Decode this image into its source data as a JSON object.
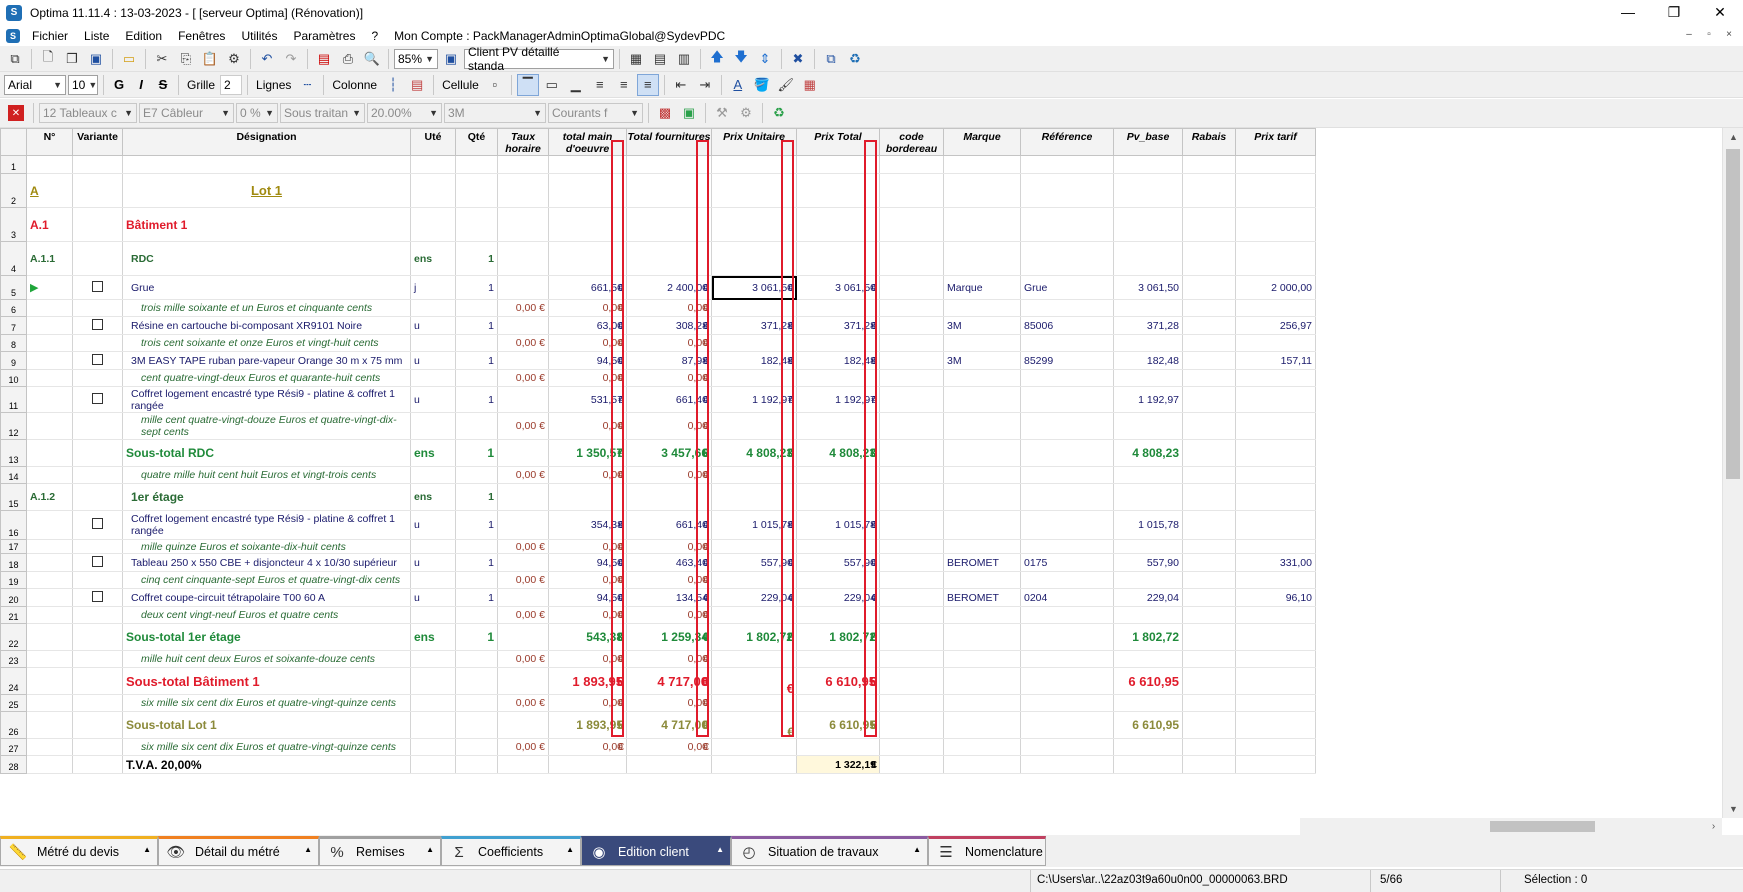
{
  "window": {
    "title": "Optima 11.11.4 : 13-03-2023 - [ [serveur Optima] (Rénovation)]",
    "minimize": "—",
    "restore": "❐",
    "close": "✕"
  },
  "menu": {
    "items": [
      "Fichier",
      "Liste",
      "Edition",
      "Fenêtres",
      "Utilités",
      "Paramètres",
      "?"
    ],
    "account": "Mon Compte : PackManagerAdminOptimaGlobal@SydevPDC",
    "mdi": [
      "–",
      "▫",
      "×"
    ]
  },
  "toolbar1": {
    "zoom": "85%",
    "client_view": "Client PV détaillé standa"
  },
  "toolbar2": {
    "font": "Arial",
    "font_size": "10",
    "bold": "G",
    "italic": "I",
    "strike": "S",
    "grille_label": "Grille",
    "grille_value": "2",
    "lignes_label": "Lignes",
    "colonne_label": "Colonne",
    "cellule_label": "Cellule"
  },
  "toolbar3": {
    "lot": "12  Tableaux c",
    "category": "E7  Câbleur",
    "pct": "0 %",
    "sous_traitance": "Sous traitan",
    "rate": "20.00%",
    "brand": "3M",
    "courants": "Courants f"
  },
  "columns": [
    "N°",
    "Variante",
    "Désignation",
    "Uté",
    "Qté",
    "Taux horaire",
    "total main d'oeuvre",
    "Total fournitures",
    "Prix Unitaire",
    "Prix Total",
    "code bordereau",
    "Marque",
    "Référence",
    "Pv_base",
    "Rabais",
    "Prix tarif"
  ],
  "rows": [
    {
      "rn": "1"
    },
    {
      "rn": "2",
      "num": "A",
      "des": "Lot 1"
    },
    {
      "rn": "3",
      "num": "A.1",
      "des": "Bâtiment 1"
    },
    {
      "rn": "4",
      "num": "A.1.1",
      "des": "RDC",
      "ute": "ens",
      "qte": "1"
    },
    {
      "rn": "5",
      "des": "Grue",
      "ute": "j",
      "qte": "1",
      "tmo": "661,50",
      "tf": "2 400,00",
      "pu": "3 061,50",
      "pt": "3 061,50",
      "marque": "Marque",
      "ref": "Grue",
      "pv": "3 061,50",
      "tarif": "2 000,00"
    },
    {
      "rn": "6",
      "des": "trois mille soixante et un Euros et cinquante cents",
      "th": "0,00 €",
      "tmo": "0,00",
      "tf": "0,00"
    },
    {
      "rn": "7",
      "des": "Résine en cartouche bi-composant XR9101 Noire",
      "ute": "u",
      "qte": "1",
      "tmo": "63,00",
      "tf": "308,28",
      "pu": "371,28",
      "pt": "371,28",
      "marque": "3M",
      "ref": "85006",
      "pv": "371,28",
      "tarif": "256,97"
    },
    {
      "rn": "8",
      "des": "trois cent  soixante et onze Euros et vingt-huit cents",
      "th": "0,00 €",
      "tmo": "0,00",
      "tf": "0,00"
    },
    {
      "rn": "9",
      "des": "3M EASY TAPE ruban pare-vapeur Orange 30 m x 75 mm",
      "ute": "u",
      "qte": "1",
      "tmo": "94,50",
      "tf": "87,98",
      "pu": "182,48",
      "pt": "182,48",
      "marque": "3M",
      "ref": "85299",
      "pv": "182,48",
      "tarif": "157,11"
    },
    {
      "rn": "10",
      "des": "cent quatre-vingt-deux Euros et quarante-huit cents",
      "th": "0,00 €",
      "tmo": "0,00",
      "tf": "0,00"
    },
    {
      "rn": "11",
      "des": "Coffret logement encastré type Rési9 - platine & coffret 1 rangée",
      "ute": "u",
      "qte": "1",
      "tmo": "531,57",
      "tf": "661,40",
      "pu": "1 192,97",
      "pt": "1 192,97",
      "pv": "1 192,97"
    },
    {
      "rn": "12",
      "des": "mille cent  quatre-vingt-douze Euros et quatre-vingt-dix-sept cents",
      "th": "0,00 €",
      "tmo": "0,00",
      "tf": "0,00"
    },
    {
      "rn": "13",
      "des": "Sous-total RDC",
      "ute": "ens",
      "qte": "1",
      "tmo": "1 350,57",
      "tf": "3 457,66",
      "pu": "4 808,23",
      "pt": "4 808,23",
      "pv": "4 808,23"
    },
    {
      "rn": "14",
      "des": "quatre mille huit cent huit Euros et vingt-trois cents",
      "th": "0,00 €",
      "tmo": "0,00",
      "tf": "0,00"
    },
    {
      "rn": "15",
      "num": "A.1.2",
      "des": "1er étage",
      "ute": "ens",
      "qte": "1"
    },
    {
      "rn": "16",
      "des": "Coffret logement encastré type Rési9 - platine & coffret 1 rangée",
      "ute": "u",
      "qte": "1",
      "tmo": "354,38",
      "tf": "661,40",
      "pu": "1 015,78",
      "pt": "1 015,78",
      "pv": "1 015,78"
    },
    {
      "rn": "17",
      "des": "mille quinze Euros et  soixante-dix-huit cents",
      "th": "0,00 €",
      "tmo": "0,00",
      "tf": "0,00"
    },
    {
      "rn": "18",
      "des": "Tableau 250 x 550 CBE + disjoncteur 4 x 10/30 supérieur",
      "ute": "u",
      "qte": "1",
      "tmo": "94,50",
      "tf": "463,40",
      "pu": "557,90",
      "pt": "557,90",
      "marque": "BEROMET",
      "ref": "0175",
      "pv": "557,90",
      "tarif": "331,00"
    },
    {
      "rn": "19",
      "des": "cinq cent cinquante-sept Euros et  quatre-vingt-dix cents",
      "th": "0,00 €",
      "tmo": "0,00",
      "tf": "0,00"
    },
    {
      "rn": "20",
      "des": "Coffret coupe-circuit tétrapolaire T00 60 A",
      "ute": "u",
      "qte": "1",
      "tmo": "94,50",
      "tf": "134,54",
      "pu": "229,04",
      "pt": "229,04",
      "marque": "BEROMET",
      "ref": "0204",
      "pv": "229,04",
      "tarif": "96,10"
    },
    {
      "rn": "21",
      "des": "deux cent vingt-neuf Euros et quatre cents",
      "th": "0,00 €",
      "tmo": "0,00",
      "tf": "0,00"
    },
    {
      "rn": "22",
      "des": "Sous-total 1er étage",
      "ute": "ens",
      "qte": "1",
      "tmo": "543,38",
      "tf": "1 259,34",
      "pu": "1 802,72",
      "pt": "1 802,72",
      "pv": "1 802,72"
    },
    {
      "rn": "23",
      "des": "mille huit cent deux Euros et  soixante-douze cents",
      "th": "0,00 €",
      "tmo": "0,00",
      "tf": "0,00"
    },
    {
      "rn": "24",
      "des": "Sous-total Bâtiment 1",
      "tmo": "1 893,95",
      "tf": "4 717,00",
      "pt": "6 610,95",
      "pv": "6 610,95"
    },
    {
      "rn": "25",
      "des": "six mille six cent dix Euros et  quatre-vingt-quinze cents",
      "th": "0,00 €",
      "tmo": "0,00",
      "tf": "0,00"
    },
    {
      "rn": "26",
      "des": "Sous-total Lot 1",
      "tmo": "1 893,95",
      "tf": "4 717,00",
      "pt": "6 610,95",
      "pv": "6 610,95"
    },
    {
      "rn": "27",
      "des": "six mille six cent dix Euros et  quatre-vingt-quinze cents",
      "th": "0,00 €",
      "tmo": "0,00",
      "tf": "0,00"
    },
    {
      "rn": "28",
      "des": "T.V.A. 20,00%",
      "pt": "1 322,19"
    }
  ],
  "tabs": [
    {
      "label": "Métré du devis",
      "icon": "ruler-icon"
    },
    {
      "label": "Détail du métré",
      "icon": "eye-icon"
    },
    {
      "label": "Remises",
      "icon": "percent-icon"
    },
    {
      "label": "Coefficients",
      "icon": "sigma-icon"
    },
    {
      "label": "Edition client",
      "icon": "user-icon"
    },
    {
      "label": "Situation de travaux",
      "icon": "clock-icon"
    },
    {
      "label": "Nomenclature",
      "icon": "list-icon"
    }
  ],
  "status": {
    "path": "C:\\Users\\ar..\\22az03t9a60u0n00_00000063.BRD",
    "page": "5/66",
    "selection": "Sélection : 0"
  },
  "colors": {
    "navy": "#1a1a6b",
    "green": "#1f8a3a",
    "red": "#e01b2b",
    "olive": "#8b8a3a",
    "active_tab": "#3a4a7c",
    "highlight_box": "#e01b2b"
  }
}
